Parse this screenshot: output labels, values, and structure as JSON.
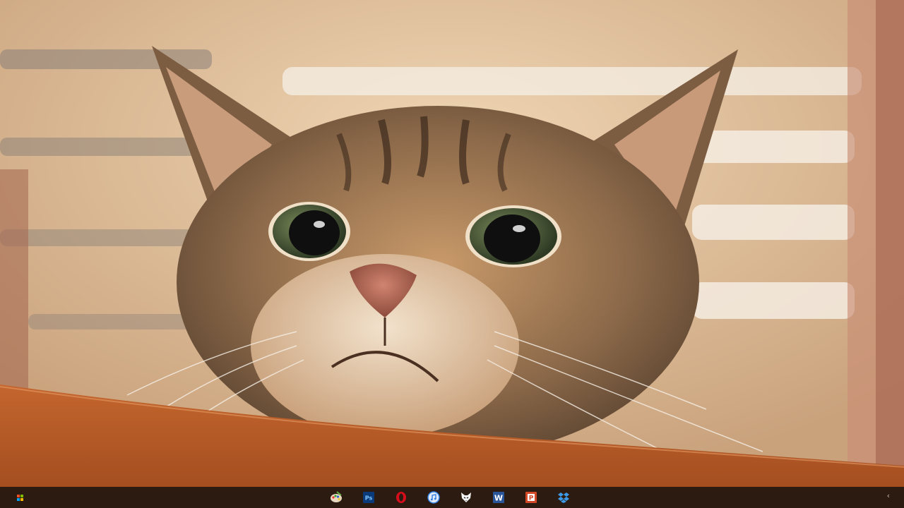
{
  "desktop": {
    "wallpaper": "tabby-cat-peeking-over-table"
  },
  "taskbar": {
    "background": "#2b1b10",
    "start_icon": "windows-start-icon",
    "pinned_apps": [
      {
        "icon": "paint-palette-icon"
      },
      {
        "icon": "photoshop-icon",
        "label": "Ps",
        "color": "#0a3a7a"
      },
      {
        "icon": "opera-icon",
        "color": "#d80d1c"
      },
      {
        "icon": "itunes-icon",
        "color": "#2f7de1"
      },
      {
        "icon": "fox-mask-icon"
      },
      {
        "icon": "word-icon",
        "label": "W",
        "color": "#2a5699"
      },
      {
        "icon": "powerpoint-icon",
        "label": "P",
        "color": "#d24726"
      },
      {
        "icon": "dropbox-icon",
        "color": "#3d9ae8"
      }
    ],
    "tray_chevron": "‹"
  }
}
